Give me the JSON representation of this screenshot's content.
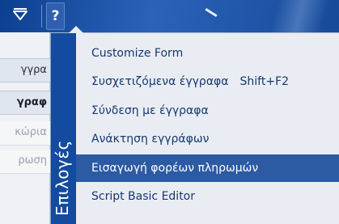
{
  "toolbar": {
    "filter_icon": "filter-funnel-icon",
    "help_label": "?",
    "accent": "#174a99"
  },
  "form": {
    "rows": [
      {
        "label": "γγρα"
      },
      {
        "label": "γραφ"
      },
      {
        "label": "κώρια"
      },
      {
        "label": "ρωση"
      }
    ]
  },
  "menu": {
    "title": "Επιλογές",
    "items": [
      {
        "label": "Customize Form",
        "shortcut": ""
      },
      {
        "label": "Συσχετιζόμενα έγγραφα",
        "shortcut": "Shift+F2"
      },
      {
        "label": "Σύνδεση με έγγραφα",
        "shortcut": ""
      },
      {
        "label": "Ανάκτηση εγγράφων",
        "shortcut": ""
      },
      {
        "label": "Εισαγωγή φορέων πληρωμών",
        "shortcut": "",
        "selected": true
      },
      {
        "label": "Script Basic Editor",
        "shortcut": ""
      }
    ],
    "colors": {
      "strip": "#124b9f",
      "selected": "#2c5aa3",
      "text": "#16386e",
      "background": "#e9edf3"
    }
  }
}
